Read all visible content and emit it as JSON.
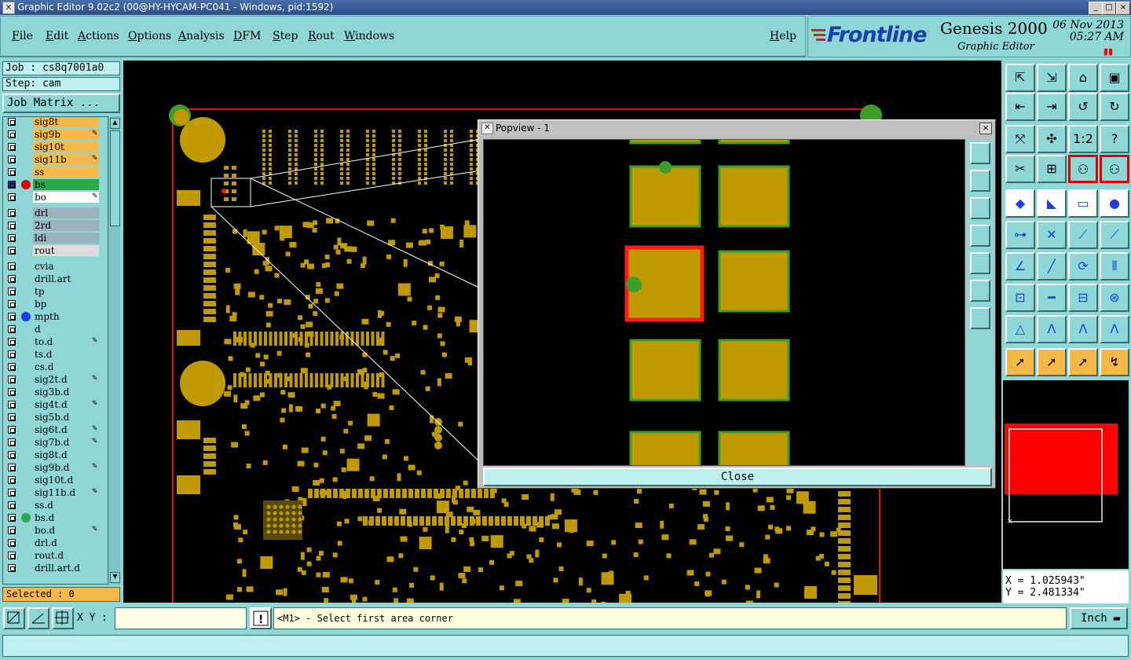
{
  "window": {
    "title": "Graphic Editor 9.02c2 (00@HY-HYCAM-PC041 - Windows, pid:1592)",
    "controls": [
      "_",
      "□",
      "×"
    ]
  },
  "menubar": {
    "items": [
      "File",
      "Edit",
      "Actions",
      "Options",
      "Analysis",
      "DFM",
      "Step",
      "Rout",
      "Windows"
    ],
    "help": "Help"
  },
  "logo": {
    "brand": "Frontline",
    "product": "Genesis 2000",
    "subtitle": "Graphic Editor",
    "date": "06 Nov 2013",
    "time": "05:27 AM"
  },
  "job": {
    "job_label": "Job : cs8q7001a0",
    "step_label": "Step: cam",
    "job_matrix": "Job Matrix ..."
  },
  "layers": [
    {
      "name": "sig8t",
      "color": "#f5b94a",
      "dot": null,
      "pen": false
    },
    {
      "name": "sig9b",
      "color": "#f5b94a",
      "dot": null,
      "pen": true
    },
    {
      "name": "sig10t",
      "color": "#f5b94a",
      "dot": null,
      "pen": false
    },
    {
      "name": "sig11b",
      "color": "#f5b94a",
      "dot": null,
      "pen": true
    },
    {
      "name": "ss",
      "color": "#f5b94a",
      "dot": null,
      "pen": false
    },
    {
      "name": "bs",
      "color": "#2ba84a",
      "dot": "#e00000",
      "pen": false,
      "sq": true
    },
    {
      "name": "bo",
      "color": "#ffffff",
      "dot": null,
      "pen": true
    },
    {
      "name": "drl",
      "color": "#9ab3bd",
      "dot": null,
      "pen": false,
      "gap": true
    },
    {
      "name": "2rd",
      "color": "#9ab3bd",
      "dot": null,
      "pen": false
    },
    {
      "name": "ldi",
      "color": "#9ab3bd",
      "dot": null,
      "pen": false
    },
    {
      "name": "rout",
      "color": "#dddddd",
      "dot": null,
      "pen": false
    },
    {
      "name": "cvia",
      "color": "#8fd6d6",
      "dot": null,
      "pen": false,
      "gap": true
    },
    {
      "name": "drill.art",
      "color": "#8fd6d6",
      "dot": null,
      "pen": false
    },
    {
      "name": "tp",
      "color": "#8fd6d6",
      "dot": null,
      "pen": false
    },
    {
      "name": "bp",
      "color": "#8fd6d6",
      "dot": null,
      "pen": false
    },
    {
      "name": "mpth",
      "color": "#8fd6d6",
      "dot": "#1a3fe8",
      "pen": false
    },
    {
      "name": "d",
      "color": "#8fd6d6",
      "dot": null,
      "pen": false
    },
    {
      "name": "to.d",
      "color": "#8fd6d6",
      "dot": null,
      "pen": true
    },
    {
      "name": "ts.d",
      "color": "#8fd6d6",
      "dot": null,
      "pen": false
    },
    {
      "name": "cs.d",
      "color": "#8fd6d6",
      "dot": null,
      "pen": false
    },
    {
      "name": "sig2t.d",
      "color": "#8fd6d6",
      "dot": null,
      "pen": true
    },
    {
      "name": "sig3b.d",
      "color": "#8fd6d6",
      "dot": null,
      "pen": false
    },
    {
      "name": "sig4t.d",
      "color": "#8fd6d6",
      "dot": null,
      "pen": true
    },
    {
      "name": "sig5b.d",
      "color": "#8fd6d6",
      "dot": null,
      "pen": false
    },
    {
      "name": "sig6t.d",
      "color": "#8fd6d6",
      "dot": null,
      "pen": true
    },
    {
      "name": "sig7b.d",
      "color": "#8fd6d6",
      "dot": null,
      "pen": true
    },
    {
      "name": "sig8t.d",
      "color": "#8fd6d6",
      "dot": null,
      "pen": false
    },
    {
      "name": "sig9b.d",
      "color": "#8fd6d6",
      "dot": null,
      "pen": true
    },
    {
      "name": "sig10t.d",
      "color": "#8fd6d6",
      "dot": null,
      "pen": false
    },
    {
      "name": "sig11b.d",
      "color": "#8fd6d6",
      "dot": null,
      "pen": true
    },
    {
      "name": "ss.d",
      "color": "#8fd6d6",
      "dot": null,
      "pen": false
    },
    {
      "name": "bs.d",
      "color": "#8fd6d6",
      "dot": "#2ba84a",
      "pen": false
    },
    {
      "name": "bo.d",
      "color": "#8fd6d6",
      "dot": null,
      "pen": true
    },
    {
      "name": "drl.d",
      "color": "#8fd6d6",
      "dot": null,
      "pen": false
    },
    {
      "name": "rout.d",
      "color": "#8fd6d6",
      "dot": null,
      "pen": false
    },
    {
      "name": "drill.art.d",
      "color": "#8fd6d6",
      "dot": null,
      "pen": false
    }
  ],
  "selected": "Selected : 0",
  "popview": {
    "title": "Popview - 1",
    "close_label": "Close"
  },
  "coords": {
    "x": "X = 1.025943\"",
    "y": "Y = 2.481334\""
  },
  "bottom": {
    "xy_label": "X Y :",
    "xy_value": "",
    "prompt": "<M1> - Select first area corner",
    "unit": "Inch"
  },
  "colors": {
    "pad": "#c09a00",
    "pad_edge": "#3c9e28",
    "highlight": "#ff1a1a",
    "profile": "#dd1111",
    "panel": "#8fd6d6"
  }
}
